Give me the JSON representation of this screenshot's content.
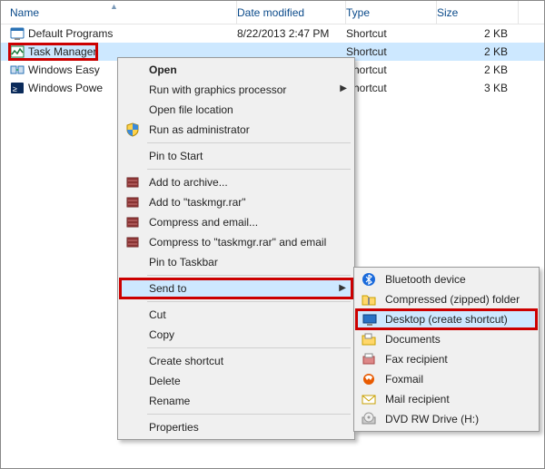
{
  "columns": {
    "name": "Name",
    "date": "Date modified",
    "type": "Type",
    "size": "Size"
  },
  "rows": [
    {
      "name": "Default Programs",
      "date": "8/22/2013 2:47 PM",
      "type": "Shortcut",
      "size": "2 KB",
      "icon": "app"
    },
    {
      "name": "Task Manager",
      "date": "",
      "type": "Shortcut",
      "size": "2 KB",
      "icon": "taskmgr",
      "selected": true,
      "boxed": true
    },
    {
      "name": "Windows Easy",
      "date": "",
      "type": "Shortcut",
      "size": "2 KB",
      "icon": "transfer"
    },
    {
      "name": "Windows Powe",
      "date": "",
      "type": "Shortcut",
      "size": "3 KB",
      "icon": "ps"
    }
  ],
  "menu1": {
    "open": "Open",
    "gfx": "Run with graphics processor",
    "loc": "Open file location",
    "admin": "Run as administrator",
    "pinstart": "Pin to Start",
    "archive": "Add to archive...",
    "addrar": "Add to \"taskmgr.rar\"",
    "compmail": "Compress and email...",
    "comprar": "Compress to \"taskmgr.rar\" and email",
    "pintask": "Pin to Taskbar",
    "sendto": "Send to",
    "cut": "Cut",
    "copy": "Copy",
    "createsc": "Create shortcut",
    "delete": "Delete",
    "rename": "Rename",
    "props": "Properties"
  },
  "menu2": {
    "bt": "Bluetooth device",
    "zip": "Compressed (zipped) folder",
    "desk": "Desktop (create shortcut)",
    "docs": "Documents",
    "fax": "Fax recipient",
    "fox": "Foxmail",
    "mail": "Mail recipient",
    "dvd": "DVD RW Drive (H:)"
  }
}
